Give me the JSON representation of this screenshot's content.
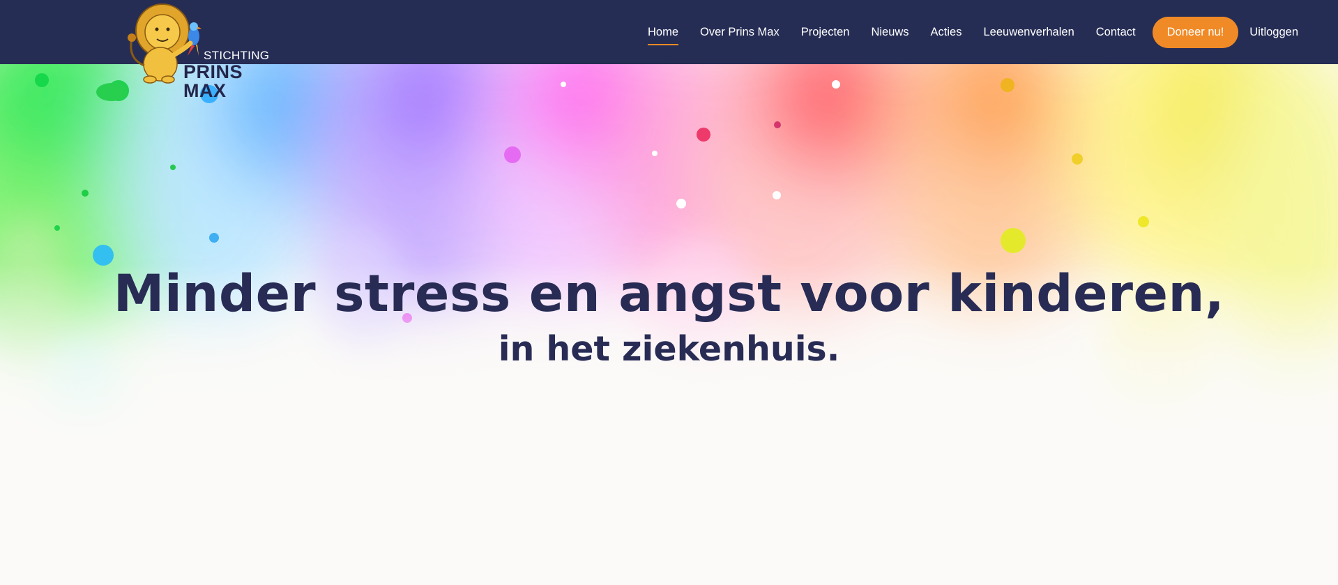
{
  "logo": {
    "line1": "STICHTING",
    "line2": "PRINS MAX"
  },
  "nav": {
    "items": [
      {
        "label": "Home",
        "active": true
      },
      {
        "label": "Over Prins Max"
      },
      {
        "label": "Projecten"
      },
      {
        "label": "Nieuws"
      },
      {
        "label": "Acties"
      },
      {
        "label": "Leeuwenverhalen"
      },
      {
        "label": "Contact"
      }
    ],
    "donate_label": "Doneer nu!",
    "logout_label": "Uitloggen"
  },
  "hero": {
    "title": "Minder stress en angst voor kinderen,",
    "subtitle": "in het ziekenhuis."
  },
  "colors": {
    "nav_bg": "#262d55",
    "accent": "#f08a26",
    "heading": "#282c55",
    "page_bg": "#fbfaf8"
  }
}
